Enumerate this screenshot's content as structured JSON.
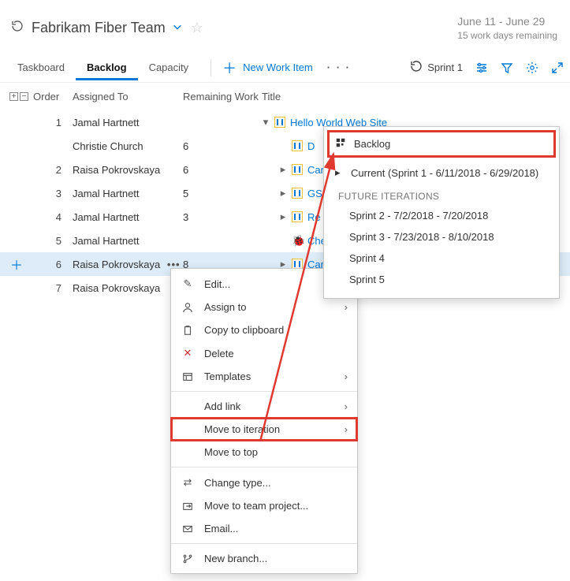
{
  "header": {
    "team_name": "Fabrikam Fiber Team",
    "date_range": "June 11 - June 29",
    "remaining": "15 work days remaining"
  },
  "tabs": {
    "taskboard": "Taskboard",
    "backlog": "Backlog",
    "capacity": "Capacity"
  },
  "toolbar": {
    "new_item": "New Work Item",
    "sprint_label": "Sprint 1"
  },
  "grid": {
    "headers": {
      "order": "Order",
      "assigned": "Assigned To",
      "remaining": "Remaining Work",
      "title": "Title"
    },
    "rows": [
      {
        "order": "1",
        "assigned": "Jamal Hartnett",
        "remaining": "",
        "kind": "backlog",
        "title": "Hello World Web Site",
        "parent": true
      },
      {
        "order": "",
        "assigned": "Christie Church",
        "remaining": "6",
        "kind": "task",
        "title": "D",
        "indent": 1
      },
      {
        "order": "2",
        "assigned": "Raisa Pokrovskaya",
        "remaining": "6",
        "kind": "task",
        "title": "Can",
        "indent": 1,
        "exp": true
      },
      {
        "order": "3",
        "assigned": "Jamal Hartnett",
        "remaining": "5",
        "kind": "task",
        "title": "GSF",
        "indent": 1,
        "exp": true
      },
      {
        "order": "4",
        "assigned": "Jamal Hartnett",
        "remaining": "3",
        "kind": "task",
        "title": "Re",
        "indent": 1,
        "exp": true
      },
      {
        "order": "5",
        "assigned": "Jamal Hartnett",
        "remaining": "",
        "kind": "bug",
        "title": "Che",
        "indent": 1
      },
      {
        "order": "6",
        "assigned": "Raisa Pokrovskaya",
        "remaining": "8",
        "kind": "task",
        "title": "Car",
        "indent": 1,
        "exp": true,
        "selected": true,
        "dots": true,
        "addbtn": true
      },
      {
        "order": "7",
        "assigned": "Raisa Pokrovskaya",
        "remaining": "",
        "kind": "task",
        "title": "",
        "indent": 1
      }
    ]
  },
  "ctx": {
    "edit": "Edit...",
    "assign": "Assign to",
    "copy": "Copy to clipboard",
    "delete": "Delete",
    "templates": "Templates",
    "addlink": "Add link",
    "moveiter": "Move to iteration",
    "movetop": "Move to top",
    "changetype": "Change type...",
    "moveteam": "Move to team project...",
    "email": "Email...",
    "newbranch": "New branch..."
  },
  "submenu": {
    "backlog": "Backlog",
    "current": "Current (Sprint 1 - 6/11/2018 - 6/29/2018)",
    "section": "FUTURE ITERATIONS",
    "s2": "Sprint 2 - 7/2/2018 - 7/20/2018",
    "s3": "Sprint 3 - 7/23/2018 - 8/10/2018",
    "s4": "Sprint 4",
    "s5": "Sprint 5"
  }
}
